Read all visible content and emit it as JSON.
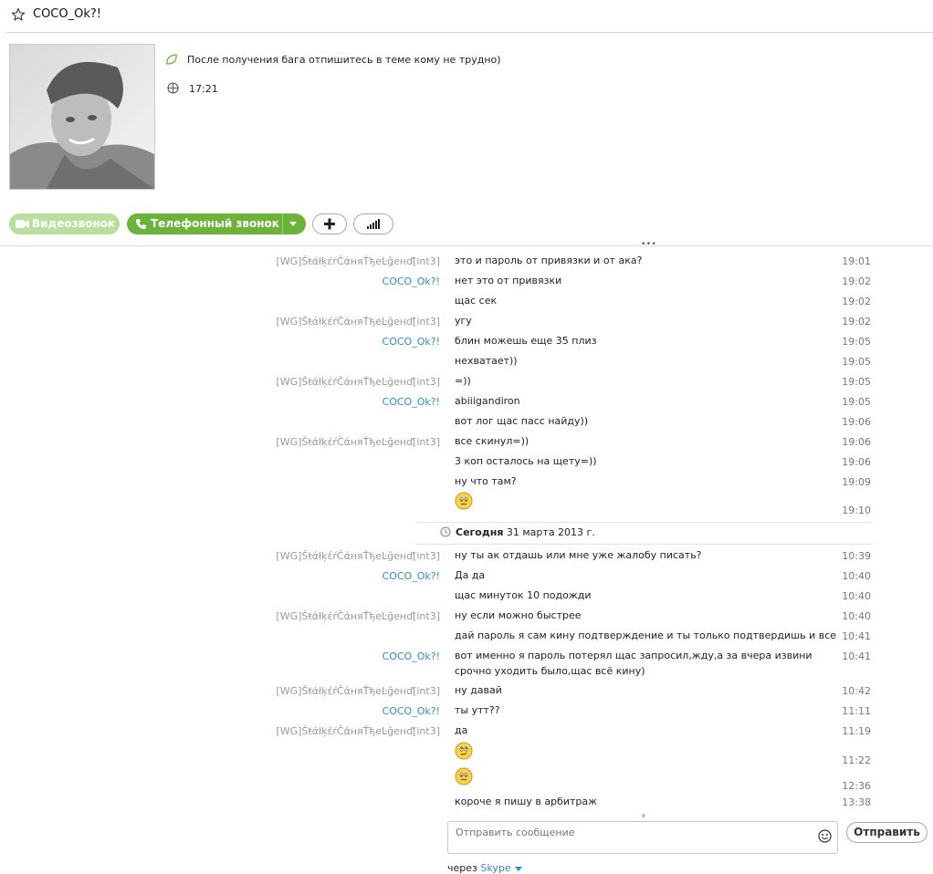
{
  "header": {
    "contact_name": "COCO_Ok?!"
  },
  "profile": {
    "mood": "После получения бага отпишитесь в теме кому не трудно)",
    "local_time": "17:21"
  },
  "actions": {
    "video_label": "Видеозвонок",
    "call_label": "Телефонный звонок"
  },
  "colors": {
    "accent_green": "#6cb33a",
    "link_blue": "#2e8dc8"
  },
  "conversation": {
    "date_separator": {
      "day": "Сегодня",
      "date": "31 марта 2013 г."
    },
    "messages_before": [
      {
        "sender": "[WG]ŠŧάłķέŕČάняŤђеĿğенď[int3]",
        "who": "peer",
        "text": "это и пароль от привязки и от ака?",
        "time": "19:01"
      },
      {
        "sender": "COCO_Ok?!",
        "who": "me",
        "text": "нет это от привязки",
        "time": "19:02"
      },
      {
        "sender": "",
        "who": "me",
        "text": "щас сек",
        "time": "19:02"
      },
      {
        "sender": "[WG]ŠŧάłķέŕČάняŤђеĿğенď[int3]",
        "who": "peer",
        "text": "угу",
        "time": "19:02"
      },
      {
        "sender": "COCO_Ok?!",
        "who": "me",
        "text": "блин можешь еще 35 плиз",
        "time": "19:05"
      },
      {
        "sender": "",
        "who": "me",
        "text": "нехватает))",
        "time": "19:05"
      },
      {
        "sender": "[WG]ŠŧάłķέŕČάняŤђеĿğенď[int3]",
        "who": "peer",
        "text": "=))",
        "time": "19:05"
      },
      {
        "sender": "COCO_Ok?!",
        "who": "me",
        "text": "abiiigandiron",
        "time": "19:05"
      },
      {
        "sender": "",
        "who": "me",
        "text": "вот лог щас пасс найду))",
        "time": "19:06"
      },
      {
        "sender": "[WG]ŠŧάłķέŕČάняŤђеĿğенď[int3]",
        "who": "peer",
        "text": "все скинул=))",
        "time": "19:06"
      },
      {
        "sender": "",
        "who": "peer",
        "text": "3 коп осталось на щету=))",
        "time": "19:06"
      },
      {
        "sender": "",
        "who": "peer",
        "text": "ну что там?",
        "time": "19:09"
      },
      {
        "sender": "",
        "who": "peer",
        "text": "",
        "emoticon": "smile-icon",
        "time": "19:10"
      }
    ],
    "messages_today": [
      {
        "sender": "[WG]ŠŧάłķέŕČάняŤђеĿğенď[int3]",
        "who": "peer",
        "text": "ну ты ак отдашь или мне уже жалобу писать?",
        "time": "10:39"
      },
      {
        "sender": "COCO_Ok?!",
        "who": "me",
        "text": "Да да",
        "time": "10:40"
      },
      {
        "sender": "",
        "who": "me",
        "text": "щас минуток 10 подожди",
        "time": "10:40"
      },
      {
        "sender": "[WG]ŠŧάłķέŕČάняŤђеĿğенď[int3]",
        "who": "peer",
        "text": "ну если можно быстрее",
        "time": "10:40"
      },
      {
        "sender": "",
        "who": "peer",
        "text": "дай пароль я сам кину подтверждение и ты только подтвердишь и все",
        "time": "10:41"
      },
      {
        "sender": "COCO_Ok?!",
        "who": "me",
        "text": "вот именно я пароль потерял щас запросил,жду,а за вчера извини срочно уходить было,щас всё кину)",
        "time": "10:41"
      },
      {
        "sender": "[WG]ŠŧάłķέŕČάняŤђеĿğенď[int3]",
        "who": "peer",
        "text": "ну давай",
        "time": "10:42"
      },
      {
        "sender": "COCO_Ok?!",
        "who": "me",
        "text": "ты утт??",
        "time": "11:11"
      },
      {
        "sender": "[WG]ŠŧάłķέŕČάняŤђеĿğенď[int3]",
        "who": "peer",
        "text": "да",
        "time": "11:19"
      },
      {
        "sender": "",
        "who": "peer",
        "text": "",
        "emoticon": "thinking-icon",
        "time": "11:22"
      },
      {
        "sender": "",
        "who": "peer",
        "text": "",
        "emoticon": "smile-icon",
        "time": "12:36"
      },
      {
        "sender": "",
        "who": "peer",
        "text": "короче я пишу в арбитраж",
        "time": "13:38"
      }
    ]
  },
  "composer": {
    "placeholder": "Отправить сообщение",
    "send_label": "Отправить",
    "via_prefix": "через",
    "via_link": "Skype"
  }
}
